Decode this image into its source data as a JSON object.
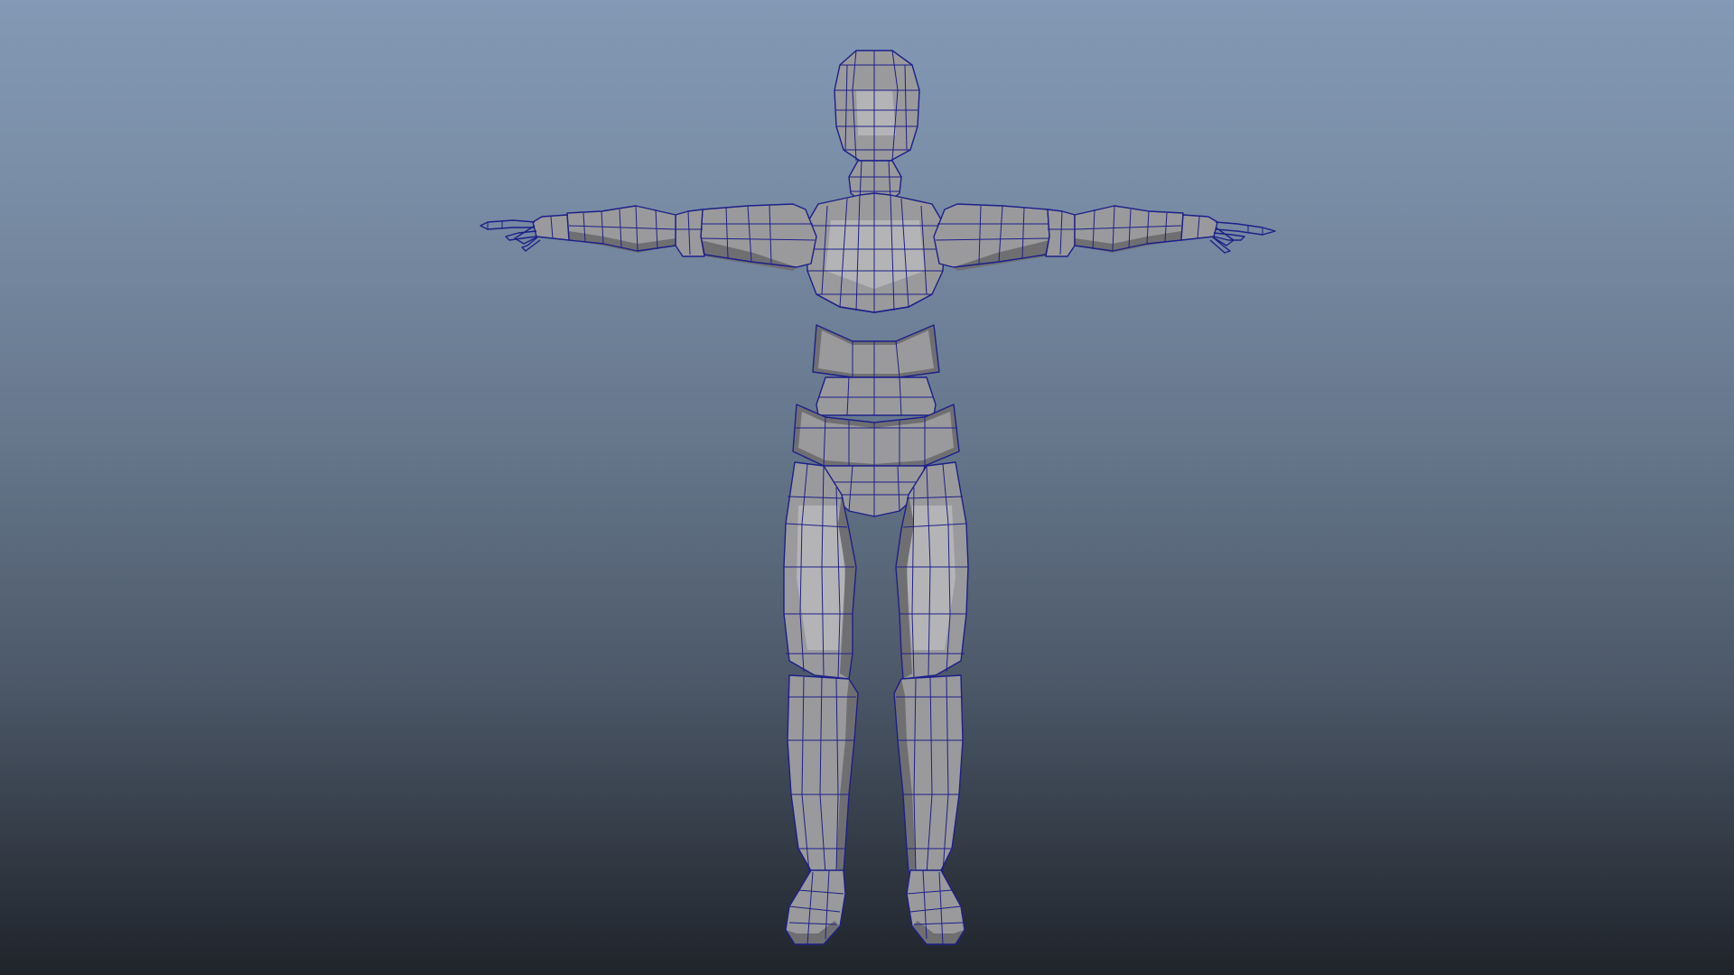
{
  "viewport": {
    "background_top": "#8399b4",
    "background_bottom": "#1f242b",
    "mesh_color": "#9a9a9c",
    "wireframe_color": "#1c1f8a"
  },
  "model": {
    "display_mode": "wireframe-on-shaded",
    "pose": "T-pose"
  }
}
